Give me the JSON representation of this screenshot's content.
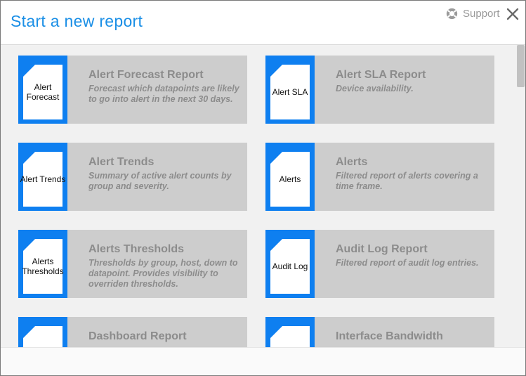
{
  "header": {
    "title": "Start a new report",
    "support_label": "Support"
  },
  "reports": [
    {
      "thumb": "Alert Forecast",
      "title": "Alert Forecast Report",
      "description": "Forecast which datapoints are likely to go into alert in the next 30 days."
    },
    {
      "thumb": "Alert SLA",
      "title": "Alert SLA Report",
      "description": "Device availability."
    },
    {
      "thumb": "Alert Trends",
      "title": "Alert Trends",
      "description": "Summary of active alert counts by group and severity."
    },
    {
      "thumb": "Alerts",
      "title": "Alerts",
      "description": "Filtered report of alerts covering a time frame."
    },
    {
      "thumb": "Alerts Thresholds",
      "title": "Alerts Thresholds",
      "description": "Thresholds by group, host, down to datapoint. Provides visibility to overriden thresholds."
    },
    {
      "thumb": "Audit Log",
      "title": "Audit Log Report",
      "description": "Filtered report of audit log entries."
    },
    {
      "thumb": "",
      "title": "Dashboard Report",
      "description": ""
    },
    {
      "thumb": "",
      "title": "Interface Bandwidth",
      "description": ""
    }
  ],
  "colors": {
    "accent": "#1b8fe6",
    "thumb_blue": "#0e7ff0",
    "card_bg": "#cdcdcd",
    "card_text": "#8c8c8c"
  }
}
